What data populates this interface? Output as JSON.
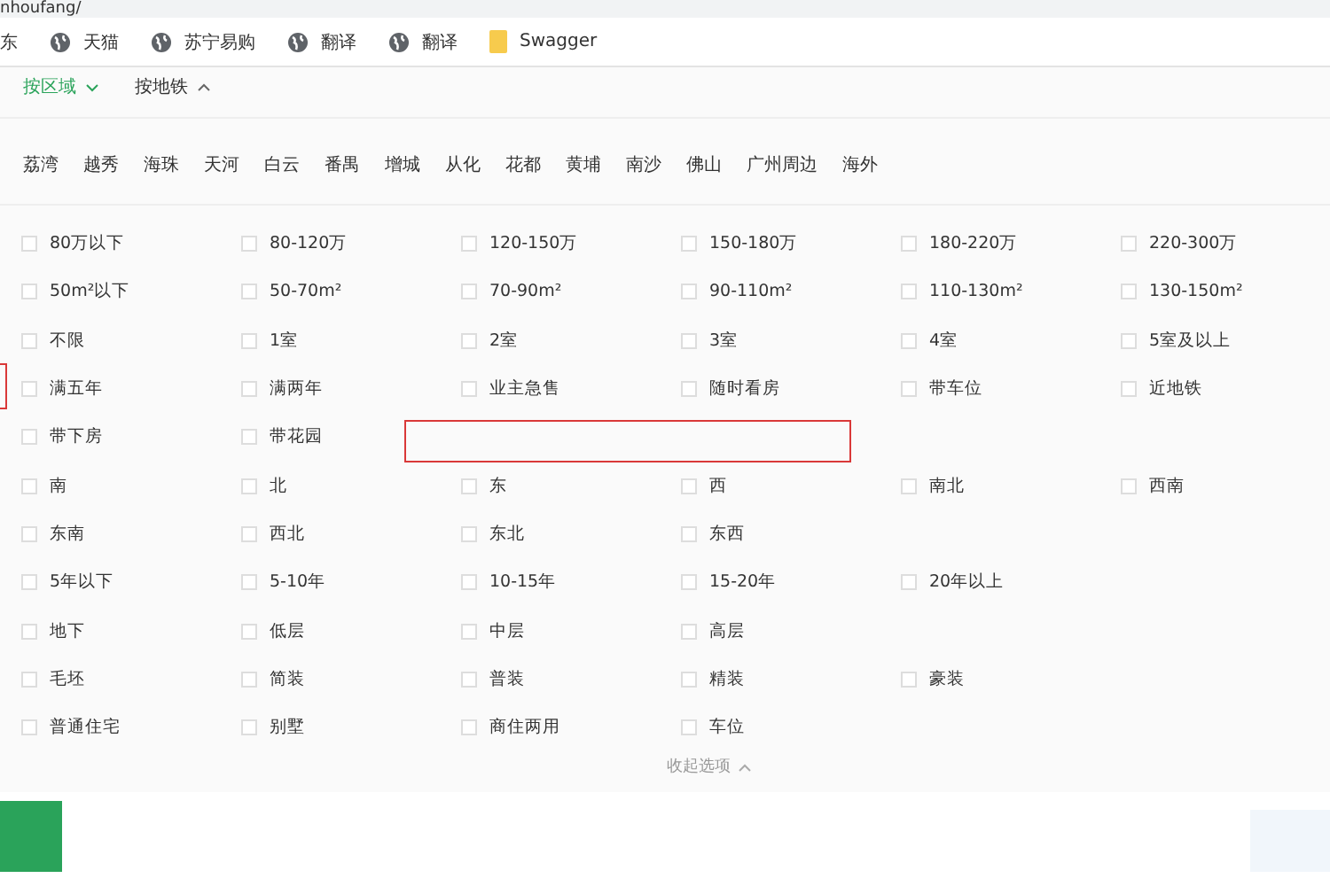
{
  "address_bar": {
    "url": "nhoufang/"
  },
  "bookmarks": [
    {
      "kind": "text",
      "label": "东"
    },
    {
      "kind": "globe",
      "label": "天猫"
    },
    {
      "kind": "globe",
      "label": "苏宁易购"
    },
    {
      "kind": "globe",
      "label": "翻译"
    },
    {
      "kind": "globe",
      "label": "翻译"
    },
    {
      "kind": "folder",
      "label": "Swagger"
    }
  ],
  "search_tabs": [
    {
      "label": "按区域",
      "selected": true,
      "expanded": false
    },
    {
      "label": "按地铁",
      "selected": false,
      "expanded": true
    }
  ],
  "districts": [
    "荔湾",
    "越秀",
    "海珠",
    "天河",
    "白云",
    "番禺",
    "增城",
    "从化",
    "花都",
    "黄埔",
    "南沙",
    "佛山",
    "广州周边",
    "海外"
  ],
  "filter_rows": [
    {
      "options": [
        {
          "label": "80万以下",
          "checked": false
        },
        {
          "label": "80-120万",
          "checked": false
        },
        {
          "label": "120-150万",
          "checked": false
        },
        {
          "label": "150-180万",
          "checked": false
        },
        {
          "label": "180-220万",
          "checked": false
        },
        {
          "label": "220-300万",
          "checked": false
        }
      ]
    },
    {
      "options": [
        {
          "label": "50m²以下",
          "checked": false
        },
        {
          "label": "50-70m²",
          "checked": false
        },
        {
          "label": "70-90m²",
          "checked": false
        },
        {
          "label": "90-110m²",
          "checked": false
        },
        {
          "label": "110-130m²",
          "checked": false
        },
        {
          "label": "130-150m²",
          "checked": false
        }
      ]
    },
    {
      "options": [
        {
          "label": "不限",
          "checked": false
        },
        {
          "label": "1室",
          "checked": false
        },
        {
          "label": "2室",
          "checked": false
        },
        {
          "label": "3室",
          "checked": false
        },
        {
          "label": "4室",
          "checked": false
        },
        {
          "label": "5室及以上",
          "checked": false
        }
      ]
    },
    {
      "options": [
        {
          "label": "满五年",
          "checked": false
        },
        {
          "label": "满两年",
          "checked": false
        },
        {
          "label": "业主急售",
          "checked": false
        },
        {
          "label": "随时看房",
          "checked": false
        },
        {
          "label": "带车位",
          "checked": false
        },
        {
          "label": "近地铁",
          "checked": false
        }
      ]
    },
    {
      "options": [
        {
          "label": "带下房",
          "checked": false
        },
        {
          "label": "带花园",
          "checked": false
        }
      ]
    },
    {
      "options": [
        {
          "label": "南",
          "checked": false
        },
        {
          "label": "北",
          "checked": false
        },
        {
          "label": "东",
          "checked": false
        },
        {
          "label": "西",
          "checked": false
        },
        {
          "label": "南北",
          "checked": false
        },
        {
          "label": "西南",
          "checked": false
        }
      ]
    },
    {
      "options": [
        {
          "label": "东南",
          "checked": false
        },
        {
          "label": "西北",
          "checked": false
        },
        {
          "label": "东北",
          "checked": false
        },
        {
          "label": "东西",
          "checked": false
        }
      ]
    },
    {
      "options": [
        {
          "label": "5年以下",
          "checked": false
        },
        {
          "label": "5-10年",
          "checked": false
        },
        {
          "label": "10-15年",
          "checked": false
        },
        {
          "label": "15-20年",
          "checked": false
        },
        {
          "label": "20年以上",
          "checked": false
        }
      ]
    },
    {
      "options": [
        {
          "label": "地下",
          "checked": false
        },
        {
          "label": "低层",
          "checked": false
        },
        {
          "label": "中层",
          "checked": false
        },
        {
          "label": "高层",
          "checked": false
        }
      ]
    },
    {
      "options": [
        {
          "label": "毛坯",
          "checked": false
        },
        {
          "label": "简装",
          "checked": false
        },
        {
          "label": "普装",
          "checked": false
        },
        {
          "label": "精装",
          "checked": false
        },
        {
          "label": "豪装",
          "checked": false
        }
      ]
    },
    {
      "options": [
        {
          "label": "普通住宅",
          "checked": false
        },
        {
          "label": "别墅",
          "checked": false
        },
        {
          "label": "商住两用",
          "checked": false
        },
        {
          "label": "车位",
          "checked": false
        }
      ]
    }
  ],
  "collapse_link": {
    "label": "收起选项"
  }
}
